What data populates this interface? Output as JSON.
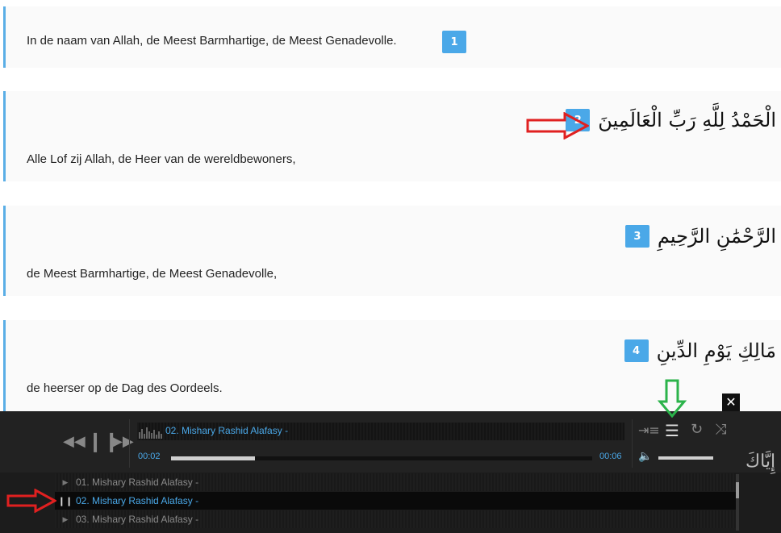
{
  "verses": [
    {
      "number": "1",
      "arabic": "",
      "translation": "In de naam van Allah, de Meest Barmhartige, de Meest Genadevolle."
    },
    {
      "number": "2",
      "arabic": "الْحَمْدُ لِلَّهِ رَبِّ الْعَالَمِينَ",
      "translation": "Alle Lof zij Allah, de Heer van de wereldbewoners,"
    },
    {
      "number": "3",
      "arabic": "الرَّحْمَٰنِ الرَّحِيمِ",
      "translation": "de Meest Barmhartige, de Meest Genadevolle,"
    },
    {
      "number": "4",
      "arabic": "مَالِكِ يَوْمِ الدِّينِ",
      "translation": "de heerser op de Dag des Oordeels."
    }
  ],
  "partial_arabic": "إِيَّاكَ",
  "player": {
    "current_track": "02. Mishary Rashid Alafasy -",
    "elapsed": "00:02",
    "duration": "00:06",
    "progress": 0.2,
    "volume": 0.95,
    "playlist": [
      {
        "label": "01. Mishary Rashid Alafasy -",
        "state": "idle"
      },
      {
        "label": "02. Mishary Rashid Alafasy -",
        "state": "playing"
      },
      {
        "label": "03. Mishary Rashid Alafasy -",
        "state": "idle"
      }
    ],
    "close_label": "✕"
  },
  "colors": {
    "accent": "#4aa8e8",
    "annotation_red": "#e02020",
    "annotation_green": "#2bb34a"
  }
}
